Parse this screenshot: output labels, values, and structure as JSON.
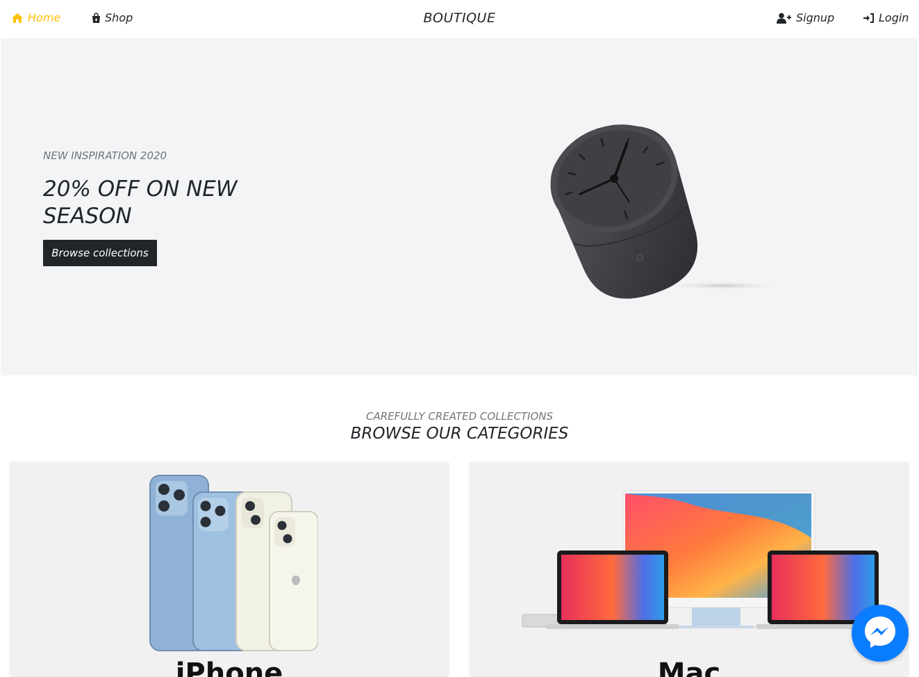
{
  "nav": {
    "home_label": "Home",
    "shop_label": "Shop",
    "brand": "BOUTIQUE",
    "signup_label": "Signup",
    "login_label": "Login",
    "home_icon": "home-icon",
    "shop_icon": "shopping-bag-icon",
    "signup_icon": "user-plus-icon",
    "login_icon": "sign-in-icon"
  },
  "hero": {
    "subtitle": "NEW INSPIRATION 2020",
    "title": "20% OFF ON NEW SEASON",
    "button_label": "Browse collections",
    "image": "desk-clock-image"
  },
  "categories": {
    "subtitle": "CAREFULLY CREATED COLLECTIONS",
    "title": "BROWSE OUR CATEGORIES",
    "items": [
      {
        "label": "iPhone",
        "image": "iphone-lineup-image"
      },
      {
        "label": "Mac",
        "image": "mac-lineup-image"
      }
    ]
  },
  "colors": {
    "accent": "#ffc107",
    "dark": "#212529",
    "hero_bg": "#f3f4f6",
    "messenger": "#0a7cff"
  },
  "widgets": {
    "messenger_icon": "messenger-icon"
  }
}
